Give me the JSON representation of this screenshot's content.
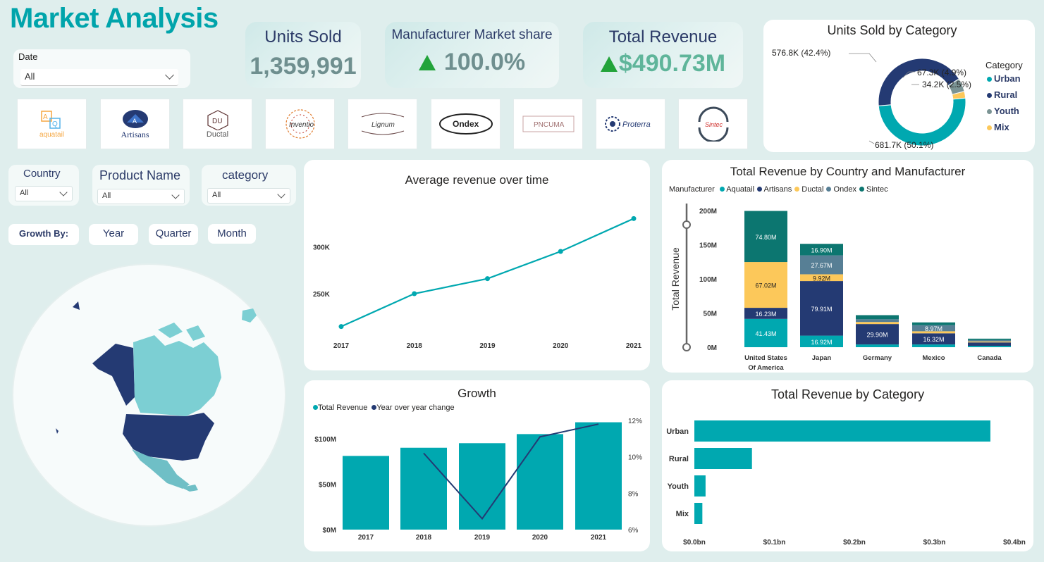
{
  "page": {
    "title": "Market Analysis"
  },
  "colors": {
    "teal": "#00a8b0",
    "navy": "#243a73",
    "yellow": "#fcc85a",
    "slate": "#577f95",
    "darkteal": "#0c7670",
    "gray": "#7b9494"
  },
  "kpis": {
    "units_sold": {
      "label": "Units Sold",
      "value": "1,359,991"
    },
    "market_share": {
      "label": "Manufacturer Market share",
      "value": "100.0%",
      "trend": "up"
    },
    "total_revenue": {
      "label": "Total Revenue",
      "value": "$490.73M",
      "trend": "up"
    }
  },
  "filters": {
    "date": {
      "label": "Date",
      "value": "All"
    },
    "country": {
      "label": "Country",
      "value": "All"
    },
    "product_name": {
      "label": "Product Name",
      "value": "All"
    },
    "category": {
      "label": "category",
      "value": "All"
    }
  },
  "growth_by": {
    "label": "Growth By:",
    "options": [
      "Year",
      "Quarter",
      "Month"
    ]
  },
  "logos": [
    "aquatail",
    "Artisans",
    "Ductal",
    "Inventio",
    "Lignum",
    "Ondex",
    "PNCUMA",
    "Proterra",
    "Sintec"
  ],
  "units_by_category": {
    "title": "Units Sold by Category",
    "legend_title": "Category",
    "legend": [
      "Urban",
      "Rural",
      "Youth",
      "Mix"
    ],
    "labels": [
      "681.7K (50.1%)",
      "576.8K (42.4%)",
      "67.3K (4.9%)",
      "34.2K (2.5%)"
    ]
  },
  "avg_revenue": {
    "title": "Average revenue over time",
    "ytick_labels": [
      "300K",
      "250K"
    ],
    "xtick_labels": [
      "2017",
      "2018",
      "2019",
      "2020",
      "2021"
    ]
  },
  "country_manufacturer": {
    "title": "Total Revenue by Country and Manufacturer",
    "legend_title": "Manufacturer",
    "legend": [
      "Aquatail",
      "Artisans",
      "Ductal",
      "Ondex",
      "Sintec"
    ],
    "ylabel": "Total Revenue",
    "ytick_labels": [
      "200M",
      "150M",
      "100M",
      "50M",
      "0M"
    ],
    "countries": [
      "United States Of America",
      "Japan",
      "Germany",
      "Mexico",
      "Canada"
    ]
  },
  "growth": {
    "title": "Growth",
    "legend": [
      "Total Revenue",
      "Year over year change"
    ],
    "left_ticks": [
      "$100M",
      "$50M",
      "$0M"
    ],
    "right_ticks": [
      "12%",
      "10%",
      "8%",
      "6%"
    ],
    "xtick_labels": [
      "2017",
      "2018",
      "2019",
      "2020",
      "2021"
    ]
  },
  "revenue_by_category": {
    "title": "Total Revenue by Category",
    "categories": [
      "Urban",
      "Rural",
      "Youth",
      "Mix"
    ],
    "xtick_labels": [
      "$0.0bn",
      "$0.1bn",
      "$0.2bn",
      "$0.3bn",
      "$0.4bn"
    ]
  },
  "chart_data": [
    {
      "type": "pie",
      "title": "Units Sold by Category",
      "categories": [
        "Urban",
        "Rural",
        "Youth",
        "Mix"
      ],
      "values": [
        681.7,
        576.8,
        67.3,
        34.2
      ],
      "percent": [
        50.1,
        42.4,
        4.9,
        2.5
      ],
      "unit": "K",
      "legend_position": "right"
    },
    {
      "type": "line",
      "title": "Average revenue over time",
      "x": [
        2017,
        2018,
        2019,
        2020,
        2021
      ],
      "values": [
        215000,
        250000,
        266000,
        295000,
        330000
      ],
      "ylim": [
        205000,
        340000
      ]
    },
    {
      "type": "bar",
      "stacked": true,
      "title": "Total Revenue by Country and Manufacturer",
      "ylabel": "Total Revenue",
      "categories": [
        "United States Of America",
        "Japan",
        "Germany",
        "Mexico",
        "Canada"
      ],
      "ylim": [
        0,
        200
      ],
      "unit": "M",
      "series": [
        {
          "name": "Aquatail",
          "values": [
            41.43,
            16.92,
            4,
            4,
            2
          ],
          "labels": [
            "41.43M",
            "16.92M",
            "",
            "",
            ""
          ]
        },
        {
          "name": "Artisans",
          "values": [
            16.23,
            79.91,
            29.9,
            16.32,
            5
          ],
          "labels": [
            "16.23M",
            "79.91M",
            "29.90M",
            "16.32M",
            ""
          ]
        },
        {
          "name": "Ductal",
          "values": [
            67.02,
            9.92,
            3,
            3,
            1.5
          ],
          "labels": [
            "67.02M",
            "9.92M",
            "",
            "",
            ""
          ]
        },
        {
          "name": "Ondex",
          "values": [
            0,
            27.67,
            4,
            8.97,
            2
          ],
          "labels": [
            "",
            "27.67M",
            "",
            "8.97M",
            ""
          ]
        },
        {
          "name": "Sintec",
          "values": [
            74.8,
            16.9,
            6,
            4,
            2
          ],
          "labels": [
            "74.80M",
            "16.90M",
            "",
            "",
            ""
          ]
        }
      ]
    },
    {
      "type": "bar",
      "title": "Growth",
      "x": [
        "2017",
        "2018",
        "2019",
        "2020",
        "2021"
      ],
      "series": [
        {
          "name": "Total Revenue",
          "type": "bar",
          "values": [
            81,
            90,
            95,
            105,
            118
          ],
          "unit": "M",
          "ylim": [
            0,
            120
          ]
        },
        {
          "name": "Year over year change",
          "type": "line",
          "values": [
            null,
            10.2,
            6.6,
            11.1,
            11.8
          ],
          "unit": "%",
          "ylim": [
            6,
            12
          ]
        }
      ]
    },
    {
      "type": "bar",
      "orientation": "horizontal",
      "title": "Total Revenue by Category",
      "categories": [
        "Urban",
        "Rural",
        "Youth",
        "Mix"
      ],
      "values": [
        0.37,
        0.072,
        0.014,
        0.01
      ],
      "unit": "bn",
      "xlim": [
        0,
        0.4
      ]
    }
  ]
}
